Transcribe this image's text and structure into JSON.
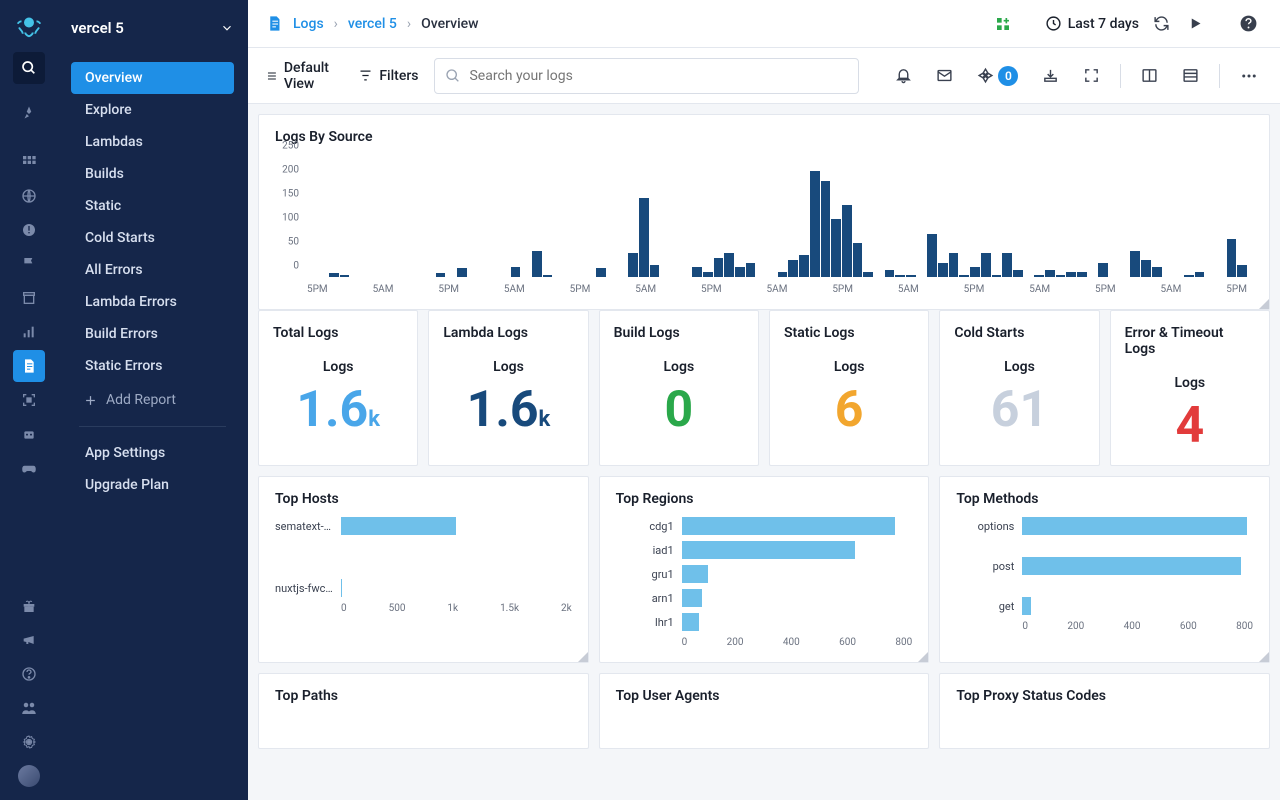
{
  "app": {
    "name": "vercel 5"
  },
  "breadcrumb": {
    "root": "Logs",
    "app": "vercel 5",
    "page": "Overview"
  },
  "topbar": {
    "time_label": "Last 7 days"
  },
  "toolbar": {
    "default_view": "Default View",
    "filters": "Filters",
    "search_placeholder": "Search your logs",
    "badge": "0"
  },
  "sidebar": {
    "items": [
      {
        "label": "Overview",
        "active": true
      },
      {
        "label": "Explore"
      },
      {
        "label": "Lambdas"
      },
      {
        "label": "Builds"
      },
      {
        "label": "Static"
      },
      {
        "label": "Cold Starts"
      },
      {
        "label": "All Errors"
      },
      {
        "label": "Lambda Errors"
      },
      {
        "label": "Build Errors"
      },
      {
        "label": "Static Errors"
      }
    ],
    "add_report": "Add Report",
    "bottom": [
      {
        "label": "App Settings"
      },
      {
        "label": "Upgrade Plan"
      }
    ]
  },
  "charts": {
    "logs_by_source": {
      "title": "Logs By Source"
    },
    "top_hosts": {
      "title": "Top Hosts"
    },
    "top_regions": {
      "title": "Top Regions"
    },
    "top_methods": {
      "title": "Top Methods"
    },
    "top_paths": {
      "title": "Top Paths"
    },
    "top_user_agents": {
      "title": "Top User Agents"
    },
    "top_proxy": {
      "title": "Top Proxy Status Codes"
    }
  },
  "metrics": [
    {
      "title": "Total Logs",
      "sub": "Logs",
      "value": "1.6",
      "suffix": "k",
      "color": "#49a6e9"
    },
    {
      "title": "Lambda Logs",
      "sub": "Logs",
      "value": "1.6",
      "suffix": "k",
      "color": "#184a7c"
    },
    {
      "title": "Build Logs",
      "sub": "Logs",
      "value": "0",
      "suffix": "",
      "color": "#2aa84a"
    },
    {
      "title": "Static Logs",
      "sub": "Logs",
      "value": "6",
      "suffix": "",
      "color": "#f2a62e"
    },
    {
      "title": "Cold Starts",
      "sub": "Logs",
      "value": "61",
      "suffix": "",
      "color": "#c7d0dd"
    },
    {
      "title": "Error & Timeout Logs",
      "sub": "Logs",
      "value": "4",
      "suffix": "",
      "color": "#e23b3b"
    }
  ],
  "chart_data": {
    "logs_by_source": {
      "type": "bar",
      "ylim": [
        0,
        250
      ],
      "yticks": [
        0,
        50,
        100,
        150,
        200,
        250
      ],
      "xticks": [
        "5PM",
        "5AM",
        "5PM",
        "5AM",
        "5PM",
        "5AM",
        "5PM",
        "5AM",
        "5PM",
        "5AM",
        "5PM",
        "5AM",
        "5PM",
        "5AM",
        "5PM"
      ],
      "values": [
        0,
        0,
        8,
        5,
        0,
        0,
        0,
        0,
        0,
        0,
        0,
        0,
        8,
        0,
        18,
        0,
        0,
        0,
        0,
        20,
        0,
        55,
        5,
        0,
        0,
        0,
        0,
        18,
        0,
        0,
        50,
        165,
        25,
        0,
        0,
        0,
        20,
        10,
        40,
        50,
        20,
        30,
        0,
        0,
        10,
        35,
        45,
        220,
        200,
        120,
        150,
        70,
        10,
        0,
        15,
        5,
        5,
        0,
        90,
        30,
        50,
        5,
        20,
        50,
        5,
        50,
        15,
        0,
        5,
        15,
        5,
        10,
        10,
        0,
        30,
        0,
        0,
        55,
        35,
        20,
        0,
        0,
        5,
        10,
        0,
        0,
        80,
        25
      ],
      "title": "Logs By Source"
    },
    "top_hosts": {
      "type": "bar",
      "orientation": "h",
      "categories": [
        "sematext-l...",
        "nuxtjs-fwc..."
      ],
      "values": [
        1000,
        5
      ],
      "xlim": [
        0,
        2000
      ],
      "xticks": [
        "0",
        "500",
        "1k",
        "1.5k",
        "2k"
      ]
    },
    "top_regions": {
      "type": "bar",
      "orientation": "h",
      "categories": [
        "cdg1",
        "iad1",
        "gru1",
        "arn1",
        "lhr1"
      ],
      "values": [
        740,
        600,
        90,
        70,
        60
      ],
      "xlim": [
        0,
        800
      ],
      "xticks": [
        "0",
        "200",
        "400",
        "600",
        "800"
      ]
    },
    "top_methods": {
      "type": "bar",
      "orientation": "h",
      "categories": [
        "options",
        "post",
        "get"
      ],
      "values": [
        780,
        760,
        30
      ],
      "xlim": [
        0,
        800
      ],
      "xticks": [
        "0",
        "200",
        "400",
        "600",
        "800"
      ]
    }
  }
}
